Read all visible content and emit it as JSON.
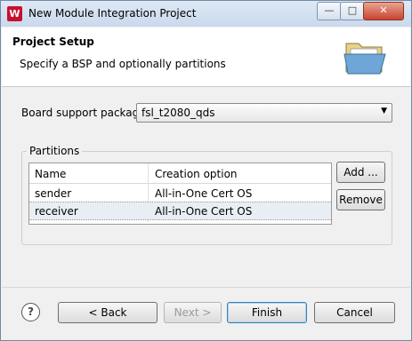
{
  "window": {
    "title": "New Module Integration Project",
    "app_icon": "W",
    "controls": {
      "minimize": "—",
      "maximize": "□",
      "close": "✕"
    }
  },
  "banner": {
    "title": "Project Setup",
    "subtitle": "Specify a BSP and optionally partitions",
    "icon": "open-folder-icon"
  },
  "bsp": {
    "label": "Board support package:",
    "value": "fsl_t2080_qds",
    "arrow": "▼"
  },
  "partitions": {
    "group_label": "Partitions",
    "columns": [
      "Name",
      "Creation option"
    ],
    "rows": [
      {
        "name": "sender",
        "option": "All-in-One Cert OS",
        "selected": false
      },
      {
        "name": "receiver",
        "option": "All-in-One Cert OS",
        "selected": true
      }
    ],
    "add_label": "Add ...",
    "remove_label": "Remove"
  },
  "footer": {
    "help": "?",
    "back": "< Back",
    "next": "Next >",
    "finish": "Finish",
    "cancel": "Cancel"
  }
}
